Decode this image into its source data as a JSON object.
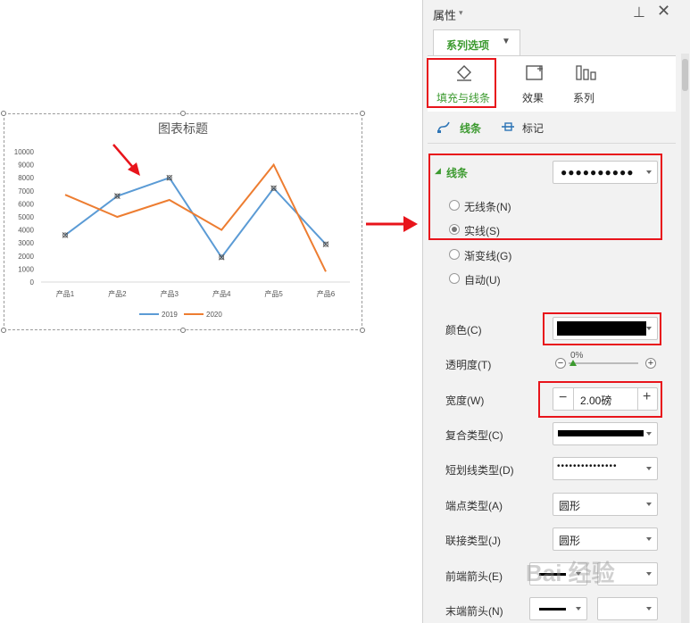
{
  "chart_data": {
    "type": "line",
    "title": "图表标题",
    "categories": [
      "产品1",
      "产品2",
      "产品3",
      "产品4",
      "产品5",
      "产品6"
    ],
    "y_ticks": [
      "10000",
      "9000",
      "8000",
      "7000",
      "6000",
      "5000",
      "4000",
      "3000",
      "2000",
      "1000",
      "0"
    ],
    "ylim": [
      0,
      10000
    ],
    "grid": false,
    "legend": "bottom",
    "series": [
      {
        "name": "2019",
        "color": "#5b9bd5",
        "values": [
          3600,
          6600,
          8000,
          1900,
          7200,
          2900
        ]
      },
      {
        "name": "2020",
        "color": "#ed7d31",
        "values": [
          6700,
          5000,
          6300,
          4000,
          9000,
          800
        ]
      }
    ]
  },
  "panel": {
    "title": "属性",
    "tab": "系列选项",
    "icon_tabs": [
      {
        "label": "填充与线条",
        "icon": "paint-bucket-icon"
      },
      {
        "label": "效果",
        "icon": "effects-icon"
      },
      {
        "label": "系列",
        "icon": "series-bars-icon"
      }
    ],
    "subtabs": [
      {
        "label": "线条",
        "icon": "line-icon"
      },
      {
        "label": "标记",
        "icon": "marker-icon"
      }
    ],
    "section_title": "线条",
    "radio_options": [
      "无线条(N)",
      "实线(S)",
      "渐变线(G)",
      "自动(U)"
    ],
    "selected_radio": "实线(S)",
    "color_label": "颜色(C)",
    "color_value": "#000000",
    "transparency_label": "透明度(T)",
    "transparency_value": "0%",
    "width_label": "宽度(W)",
    "width_value": "2.00磅",
    "compound_label": "复合类型(C)",
    "dash_label": "短划线类型(D)",
    "cap_label": "端点类型(A)",
    "cap_value": "圆形",
    "join_label": "联接类型(J)",
    "join_value": "圆形",
    "begin_arrow_label": "前端箭头(E)",
    "end_arrow_label": "末端箭头(N)",
    "watermark": "Bai 经验"
  },
  "colors": {
    "accent": "#3c9a2f",
    "highlight": "#e8141b"
  }
}
